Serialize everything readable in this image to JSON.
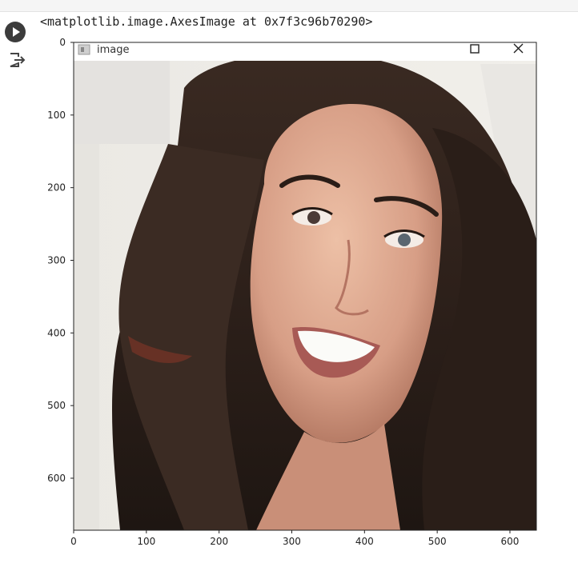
{
  "notebook": {
    "output_text": "<matplotlib.image.AxesImage at 0x7f3c96b70290>",
    "run_icon": "play-icon",
    "output_icon": "output-redirect-icon"
  },
  "image_window": {
    "title": "image",
    "window_icon": "image-window-icon",
    "maximize_icon": "maximize-icon",
    "close_icon": "close-icon"
  },
  "axes": {
    "x_ticks": [
      "0",
      "100",
      "200",
      "300",
      "400",
      "500",
      "600"
    ],
    "y_ticks": [
      "0",
      "100",
      "200",
      "300",
      "400",
      "500",
      "600"
    ]
  },
  "image_content": {
    "description_icon": "portrait-photo",
    "colors": {
      "background": "#f3f2ee",
      "hair": "#2e211b",
      "skin": "#d9a58f"
    }
  }
}
